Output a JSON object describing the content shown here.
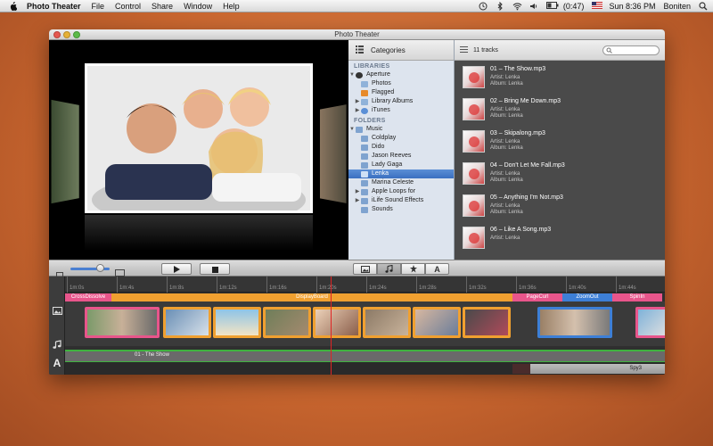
{
  "menubar": {
    "app": "Photo Theater",
    "items": [
      "File",
      "Control",
      "Share",
      "Window",
      "Help"
    ],
    "battery": "(0:47)",
    "clock": "Sun 8:36 PM",
    "user": "Boniten"
  },
  "window": {
    "title": "Photo Theater"
  },
  "library": {
    "header": "Categories",
    "sections": {
      "libraries": "LIBRARIES",
      "folders": "FOLDERS"
    },
    "library_items": [
      {
        "label": "Aperture",
        "indent": 0,
        "expanded": true
      },
      {
        "label": "Photos",
        "indent": 2
      },
      {
        "label": "Flagged",
        "indent": 2
      },
      {
        "label": "Library Albums",
        "indent": 1
      },
      {
        "label": "iTunes",
        "indent": 1
      }
    ],
    "folder_items": [
      {
        "label": "Music",
        "indent": 0
      },
      {
        "label": "Coldplay",
        "indent": 2
      },
      {
        "label": "Dido",
        "indent": 2
      },
      {
        "label": "Jason Reeves",
        "indent": 2
      },
      {
        "label": "Lady Gaga",
        "indent": 2
      },
      {
        "label": "Lenka",
        "indent": 2,
        "selected": true
      },
      {
        "label": "Marina Celeste",
        "indent": 2
      },
      {
        "label": "Apple Loops for",
        "indent": 1
      },
      {
        "label": "iLife Sound Effects",
        "indent": 1
      },
      {
        "label": "Sounds",
        "indent": 1
      }
    ]
  },
  "tracks": {
    "count_label": "11 tracks",
    "items": [
      {
        "title": "01 – The Show.mp3",
        "artist": "Artist: Lenka",
        "album": "Album: Lenka"
      },
      {
        "title": "02 – Bring Me Down.mp3",
        "artist": "Artist: Lenka",
        "album": "Album: Lenka"
      },
      {
        "title": "03 – Skipalong.mp3",
        "artist": "Artist: Lenka",
        "album": "Album: Lenka"
      },
      {
        "title": "04 – Don't Let Me Fall.mp3",
        "artist": "Artist: Lenka",
        "album": "Album: Lenka"
      },
      {
        "title": "05 – Anything I'm Not.mp3",
        "artist": "Artist: Lenka",
        "album": "Album: Lenka"
      },
      {
        "title": "06 – Like A Song.mp3",
        "artist": "Artist: Lenka",
        "album": ""
      }
    ]
  },
  "timeline": {
    "ticks": [
      "1m:0s",
      "1m:4s",
      "1m:8s",
      "1m:12s",
      "1m:16s",
      "1m:20s",
      "1m:24s",
      "1m:28s",
      "1m:32s",
      "1m:36s",
      "1m:40s",
      "1m:44s"
    ],
    "transitions": [
      {
        "label": "CrossDissolve",
        "color": "#e8558b"
      },
      {
        "label": "DisplayBoard",
        "color": "#f0a030"
      },
      {
        "label": "PageCurl",
        "color": "#e8558b"
      },
      {
        "label": "ZoomOut",
        "color": "#3d7fd6"
      },
      {
        "label": "SpinIn",
        "color": "#e8558b"
      }
    ],
    "audio_label": "01 - The Show",
    "text_label": "Spy3"
  },
  "colors": {
    "accent_pink": "#e8558b",
    "accent_orange": "#f0a030",
    "accent_blue": "#3d7fd6",
    "audio_green": "#3fb33f",
    "playhead_red": "#e02424"
  }
}
